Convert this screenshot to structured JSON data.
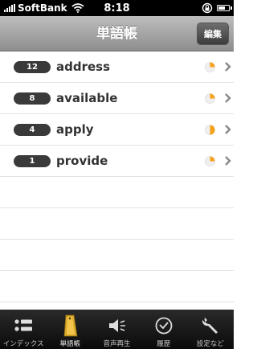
{
  "status_bar": {
    "carrier": "SoftBank",
    "time": "8:18"
  },
  "nav": {
    "title": "単語帳",
    "edit_label": "編集"
  },
  "words": [
    {
      "count": "12",
      "word": "address",
      "progress": 0.25
    },
    {
      "count": "8",
      "word": "available",
      "progress": 0.25
    },
    {
      "count": "4",
      "word": "apply",
      "progress": 0.5
    },
    {
      "count": "1",
      "word": "provide",
      "progress": 0.25
    }
  ],
  "tabs": [
    {
      "label": "インデックス",
      "icon": "list-icon"
    },
    {
      "label": "単語帳",
      "icon": "word-card-icon",
      "active": true
    },
    {
      "label": "音声再生",
      "icon": "speaker-icon"
    },
    {
      "label": "履歴",
      "icon": "clock-icon"
    },
    {
      "label": "設定など",
      "icon": "wrench-icon"
    }
  ],
  "colors": {
    "pie_fill": "#f7a11a",
    "pie_bg": "#efefef",
    "badge": "#3a3a3a",
    "chevron": "#8a8a8a"
  }
}
